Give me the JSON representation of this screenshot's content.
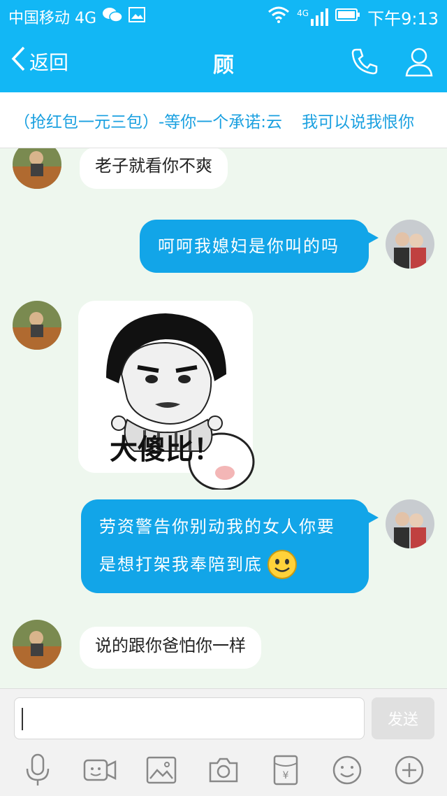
{
  "status": {
    "carrier": "中国移动 4G",
    "network": "4G",
    "time": "下午9:13"
  },
  "header": {
    "back_label": "返回",
    "title": "顾"
  },
  "banner": {
    "left_text": "（抢红包一元三包）-等你一个承诺:云",
    "right_text": "我可以说我恨你"
  },
  "messages": [
    {
      "side": "in",
      "text": "老子就看你不爽"
    },
    {
      "side": "out",
      "text": "呵呵我媳妇是你叫的吗"
    },
    {
      "side": "in",
      "sticker_text": "大傻比！"
    },
    {
      "side": "out",
      "line1": "劳资警告你别动我的女人你要",
      "line2": "是想打架我奉陪到底"
    },
    {
      "side": "in",
      "text": "说的跟你爸怕你一样"
    }
  ],
  "composer": {
    "input_value": "",
    "send_label": "发送"
  },
  "colors": {
    "brand": "#12b7f5",
    "bubble_out": "#12a5e8",
    "chat_bg": "#eef7ee"
  }
}
